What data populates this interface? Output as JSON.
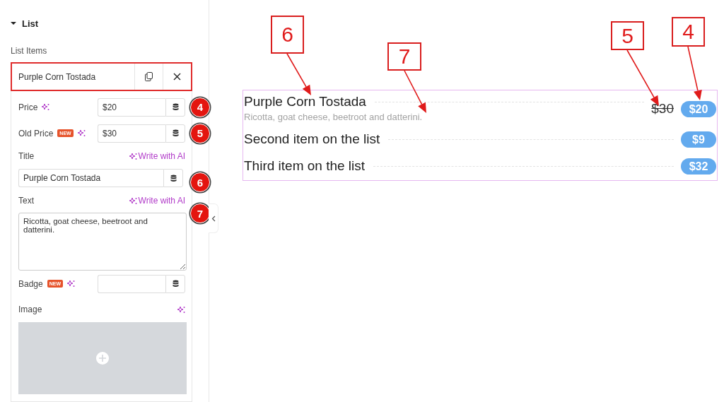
{
  "panel": {
    "section": {
      "title": "List",
      "expanded": true
    },
    "list_label": "List Items",
    "item_header": {
      "title": "Purple Corn Tostada"
    },
    "fields": [
      {
        "kind": "inline",
        "label": "Price",
        "ai": true,
        "value": "$20",
        "callout": "4"
      },
      {
        "kind": "inline",
        "label": "Old Price",
        "badge": "NEW",
        "ai": true,
        "value": "$30",
        "callout": "5"
      },
      {
        "kind": "stacked",
        "label": "Title",
        "ai_link": "Write with AI",
        "value": "Purple Corn Tostada",
        "callout": "6"
      },
      {
        "kind": "textarea",
        "label": "Text",
        "ai_link": "Write with AI",
        "value": "Ricotta, goat cheese, beetroot and datterini.",
        "callout": "7"
      },
      {
        "kind": "inline",
        "label": "Badge",
        "badge": "NEW",
        "ai": true
      },
      {
        "kind": "image",
        "label": "Image",
        "ai": true
      }
    ]
  },
  "preview": {
    "items": [
      {
        "title": "Purple Corn Tostada",
        "description": "Ricotta, goat cheese, beetroot and datterini.",
        "old_price": "$30",
        "price": "$20"
      },
      {
        "title": "Second item on the list",
        "price": "$9"
      },
      {
        "title": "Third item on the list",
        "price": "$32"
      }
    ]
  },
  "annotations": [
    {
      "label": "6"
    },
    {
      "label": "7"
    },
    {
      "label": "5"
    },
    {
      "label": "4"
    }
  ]
}
